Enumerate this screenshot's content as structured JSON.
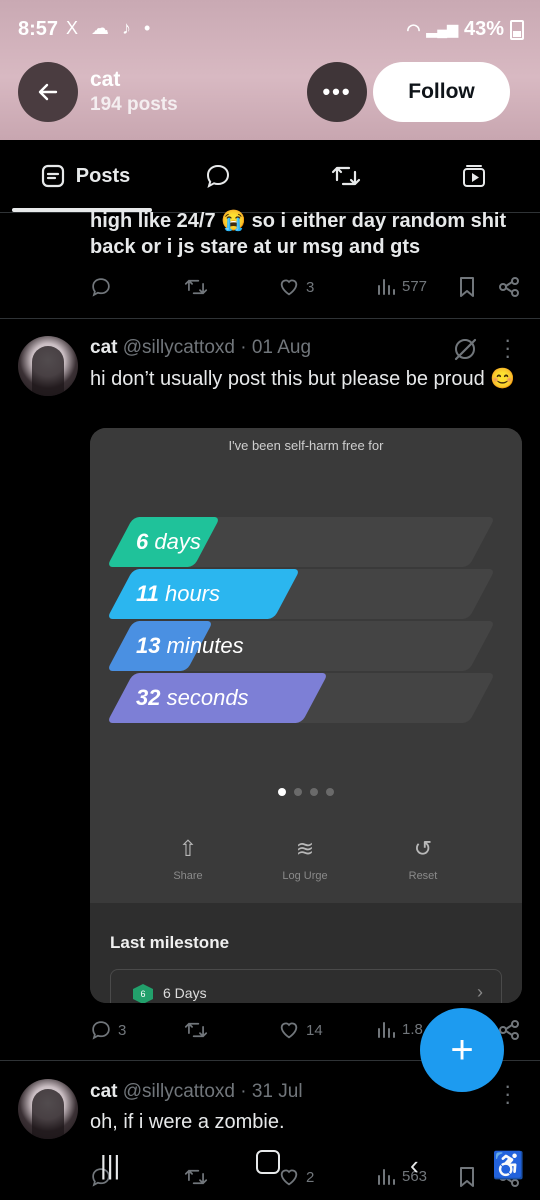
{
  "status_bar": {
    "time": "8:57",
    "left_icons": "X ☁ ♪ •",
    "battery": "43%"
  },
  "header": {
    "name": "cat",
    "posts_count": "194 posts",
    "follow_label": "Follow"
  },
  "tabs": [
    {
      "label": "Posts"
    }
  ],
  "post_prev": {
    "text": "high like 24/7 😭 so i either day random shit back or i js stare at ur msg and gts",
    "likes": "3",
    "views": "577"
  },
  "post_main": {
    "name": "cat",
    "handle": "@sillycattoxd · 01 Aug",
    "text": "hi don’t usually post this but please be proud 😊",
    "replies": "3",
    "likes": "14",
    "views": "1.8",
    "card": {
      "title": "I've been self-harm free for",
      "bars": [
        {
          "num": "6",
          "unit": "days",
          "fill": 0.24
        },
        {
          "num": "11",
          "unit": "hours",
          "fill": 0.46
        },
        {
          "num": "13",
          "unit": "minutes",
          "fill": 0.22
        },
        {
          "num": "32",
          "unit": "seconds",
          "fill": 0.54
        }
      ],
      "share": "Share",
      "log_urge": "Log Urge",
      "reset": "Reset",
      "milestone_title": "Last milestone",
      "milestone_badge": "6",
      "milestone_value": "6 Days"
    }
  },
  "post_next": {
    "name": "cat",
    "handle": "@sillycattoxd · 31 Jul",
    "text": "oh, if i were a zombie.",
    "likes": "2",
    "views": "563"
  },
  "colors": {
    "accent": "#1d9bf0",
    "bar1": "#1fc29a",
    "bar2": "#2bb6ef",
    "bar3": "#4a90e2",
    "bar4": "#7d7fd6"
  }
}
